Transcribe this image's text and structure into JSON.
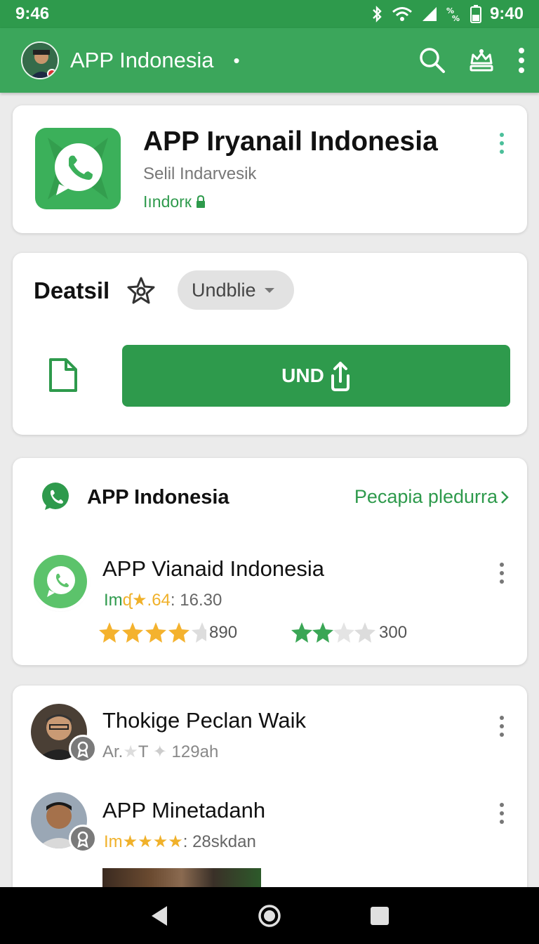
{
  "status_bar": {
    "time_left": "9:46",
    "time_right": "9:40"
  },
  "app_bar": {
    "title": "APP Indonesia",
    "dot": "•"
  },
  "app_header": {
    "title": "APP Iryanail Indonesia",
    "subtitle": "Selil Indarvesik",
    "tag": "Iındorк"
  },
  "details": {
    "title": "Deatsil",
    "dropdown_value": "Undblie",
    "button_label": "UND"
  },
  "app_list": {
    "title": "APP Indonesia",
    "link": "Pecapia pledurra",
    "item": {
      "title": "APP Vianaid Indonesia",
      "meta_prefix": "Im",
      "meta_rating": "ᶑ★.64",
      "meta_value": ": 16.30",
      "rating_a": 4.5,
      "count_a": "890",
      "rating_b": 2,
      "count_b": "300"
    }
  },
  "reviews": [
    {
      "name": "Thokige Peclan Waik",
      "meta_a": "Ar.",
      "meta_b": "T",
      "meta_c": "129ah"
    },
    {
      "name": "APP Minetadanh",
      "meta_prefix": "Im",
      "meta_stars": "★★★★",
      "meta_value": ": 28skdan"
    }
  ],
  "colors": {
    "primary": "#2e9a4c",
    "appbar": "#3ba65b",
    "star_orange": "#f4b22e",
    "star_green": "#3aa655"
  },
  "icons": [
    "bluetooth-icon",
    "wifi-icon",
    "signal-icon",
    "battery-icon",
    "search-icon",
    "crown-icon",
    "more-vert-icon",
    "chat-bubble-icon",
    "star-outline-icon",
    "document-icon",
    "share-icon",
    "back-nav-icon",
    "home-nav-icon",
    "recents-nav-icon"
  ]
}
